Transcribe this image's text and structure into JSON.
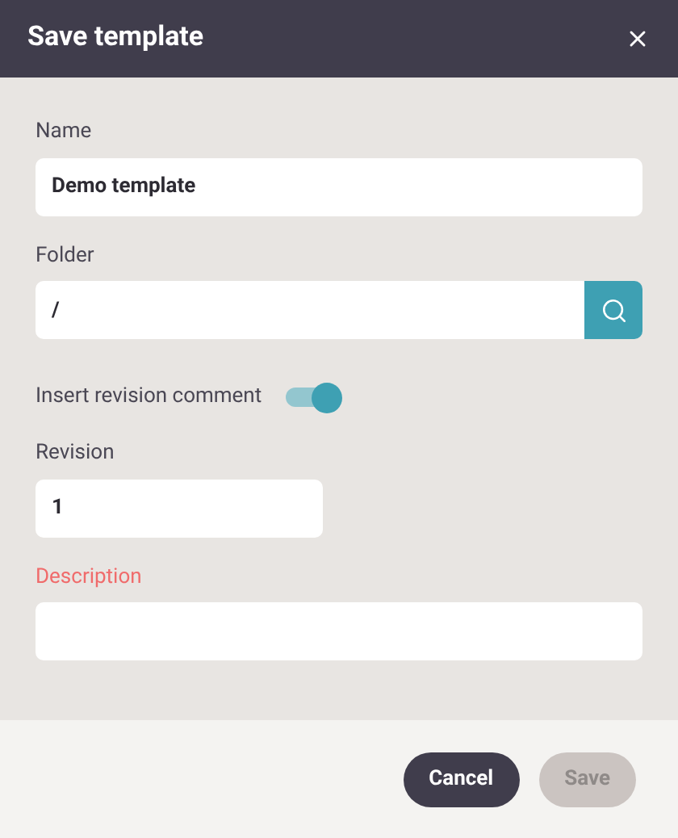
{
  "window": {
    "title": "Save template"
  },
  "fields": [
    {
      "kind": "text",
      "label": "Name",
      "value": "Demo template",
      "invalid": false
    },
    {
      "kind": "search",
      "label": "Folder",
      "value": "/",
      "invalid": false
    },
    {
      "kind": "toggle",
      "label": "Insert revision comment",
      "on": true
    },
    {
      "kind": "short",
      "label": "Revision",
      "value": "1",
      "invalid": false
    },
    {
      "kind": "text",
      "label": "Description",
      "invalid": true
    }
  ],
  "buttons": [
    {
      "label": "Cancel",
      "disabled": false
    },
    {
      "label": "Save",
      "disabled": true
    }
  ]
}
